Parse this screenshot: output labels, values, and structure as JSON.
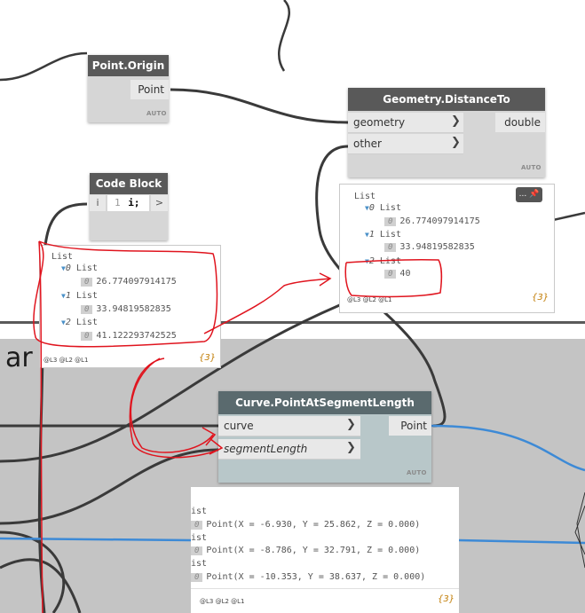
{
  "group": {
    "title_fragment": "ar"
  },
  "point_origin": {
    "title": "Point.Origin",
    "output": "Point",
    "lacing": "AUTO"
  },
  "distance_to": {
    "title": "Geometry.DistanceTo",
    "input1": "geometry",
    "input2": "other",
    "output": "double",
    "lacing": "AUTO"
  },
  "code_block": {
    "title": "Code Block",
    "port": "i",
    "line_no": "1",
    "code": "i;",
    "out": ">"
  },
  "code_preview": {
    "root": "List",
    "items": [
      {
        "label": "0",
        "sub": "List",
        "index": "0",
        "value": "26.774097914175"
      },
      {
        "label": "1",
        "sub": "List",
        "index": "0",
        "value": "33.94819582835"
      },
      {
        "label": "2",
        "sub": "List",
        "index": "0",
        "value": "41.122293742525"
      }
    ],
    "levels": "@L3 @L2 @L1",
    "count": "{3}"
  },
  "distance_preview": {
    "root": "List",
    "pin_label": "...",
    "items": [
      {
        "label": "0",
        "sub": "List",
        "index": "0",
        "value": "26.774097914175"
      },
      {
        "label": "1",
        "sub": "List",
        "index": "0",
        "value": "33.94819582835"
      },
      {
        "label": "2",
        "sub": "List",
        "index": "0",
        "value": "40"
      }
    ],
    "levels": "@L3 @L2 @L1",
    "count": "{3}"
  },
  "curve_node": {
    "title": "Curve.PointAtSegmentLength",
    "input1": "curve",
    "input2": "segmentLength",
    "output": "Point",
    "lacing": "AUTO"
  },
  "curve_preview": {
    "rows": [
      {
        "head": "ist",
        "index": "0",
        "value": "Point(X = -6.930, Y = 25.862, Z = 0.000)"
      },
      {
        "head": "ist",
        "index": "0",
        "value": "Point(X = -8.786, Y = 32.791, Z = 0.000)"
      },
      {
        "head": "ist",
        "index": "0",
        "value": "Point(X = -10.353, Y = 38.637, Z = 0.000)"
      }
    ],
    "levels": "@L3 @L2 @L1",
    "count": "{3}"
  },
  "colors": {
    "wire": "#3a3a3a",
    "wire_blue": "#3d8ad6",
    "annotation": "#e0141e",
    "node_header": "#595959",
    "curve_header": "#5a6a6e",
    "curve_body": "#b8c7c9"
  }
}
